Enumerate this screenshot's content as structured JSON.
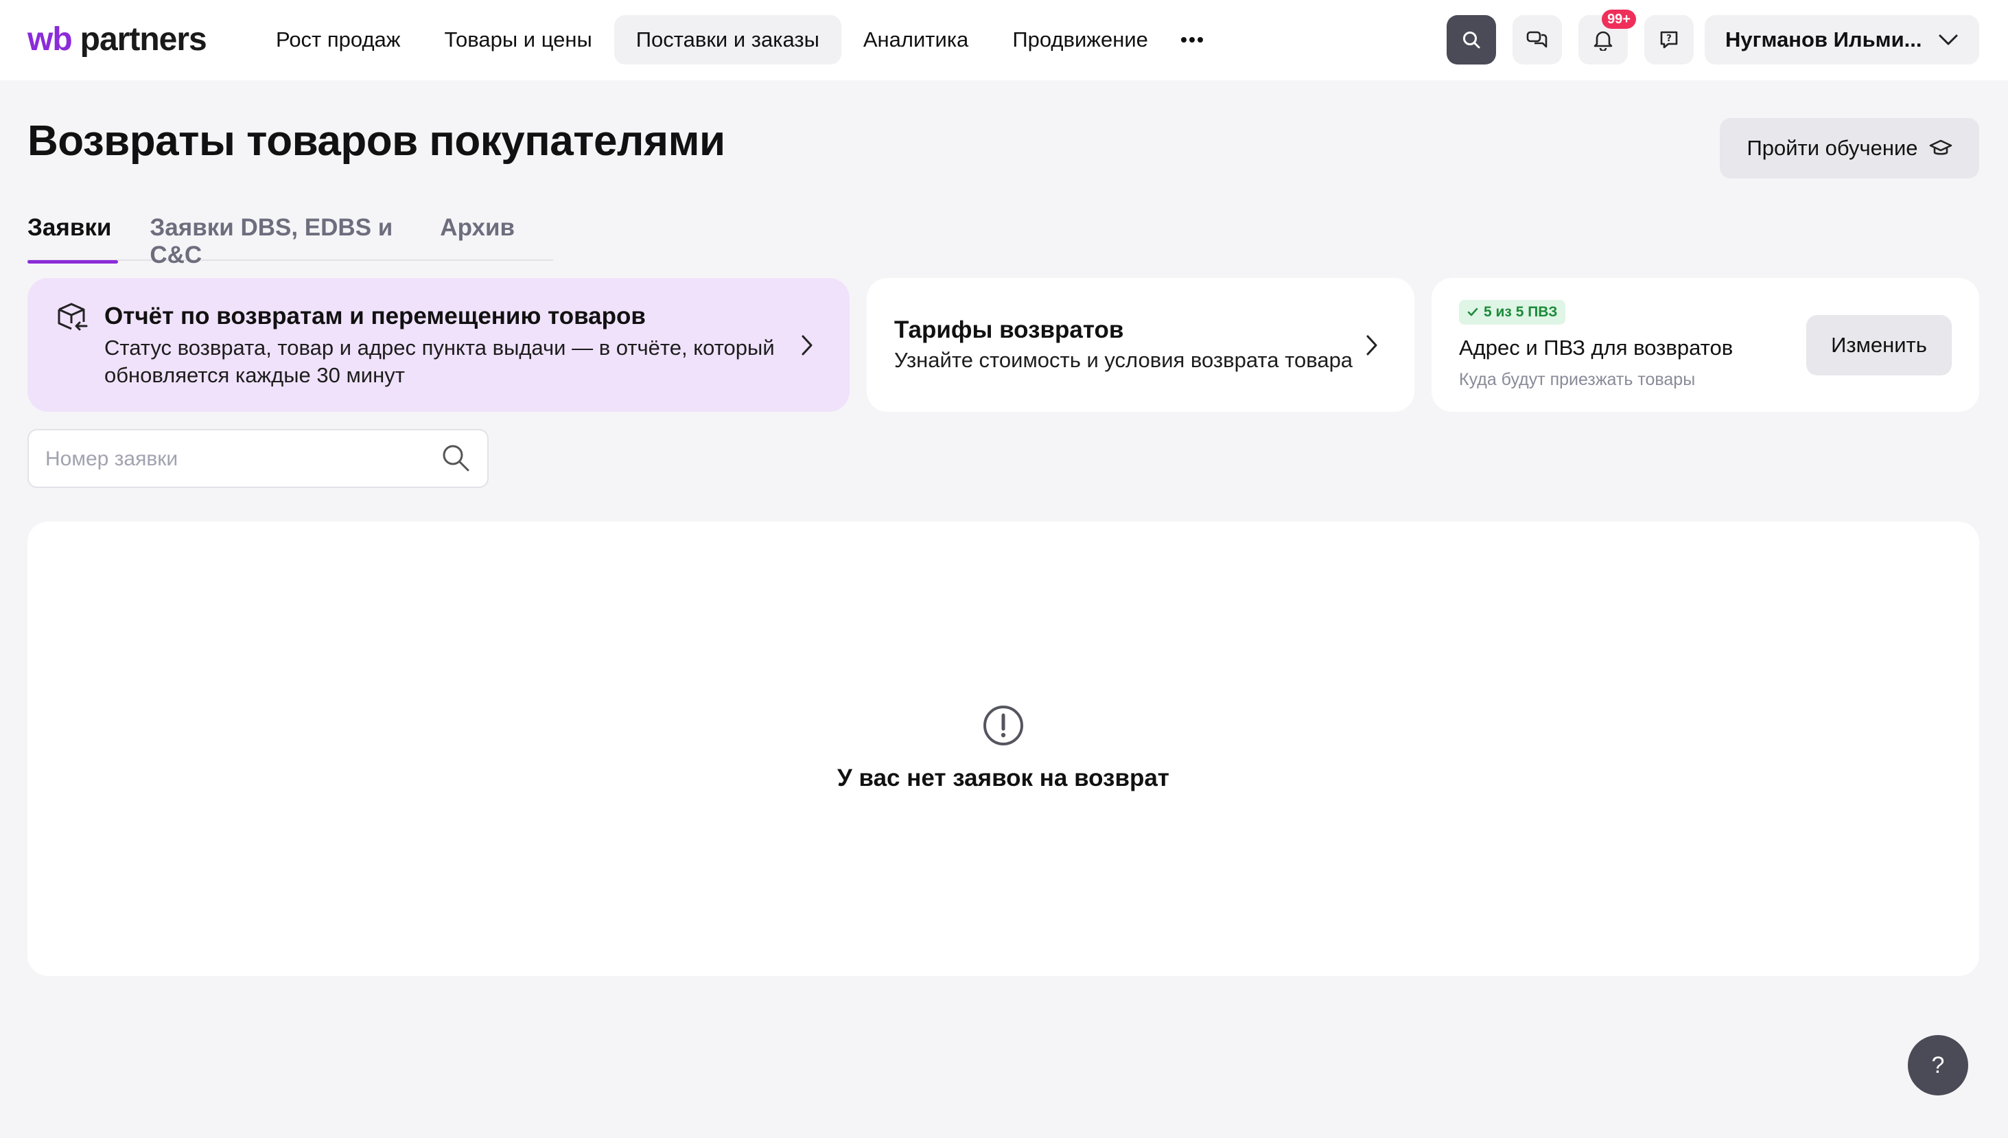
{
  "header": {
    "logo": {
      "wb": "wb",
      "partners": "partners"
    },
    "nav": [
      {
        "label": "Рост продаж"
      },
      {
        "label": "Товары и цены"
      },
      {
        "label": "Поставки и заказы"
      },
      {
        "label": "Аналитика"
      },
      {
        "label": "Продвижение"
      }
    ],
    "notifications_badge": "99+",
    "user_name": "Нугманов Ильми...",
    "icons": [
      "more-icon",
      "search-icon",
      "chat-icon",
      "bell-icon",
      "support-icon",
      "chevron-down-icon"
    ]
  },
  "page": {
    "title": "Возвраты товаров покупателями",
    "learn_button": "Пройти обучение"
  },
  "tabs": [
    {
      "label": "Заявки"
    },
    {
      "label": "Заявки DBS, EDBS и C&C"
    },
    {
      "label": "Архив"
    }
  ],
  "cards": {
    "report": {
      "title": "Отчёт по возвратам и перемещению товаров",
      "desc": "Статус возврата, товар и адрес пункта выдачи — в отчёте, который обновляется каждые 30 минут"
    },
    "tariffs": {
      "title": "Тарифы возвратов",
      "desc": "Узнайте стоимость и условия возврата товара"
    },
    "address": {
      "badge": "5 из 5 ПВЗ",
      "title": "Адрес и ПВЗ для возвратов",
      "subtitle": "Куда будут приезжать товары",
      "button": "Изменить"
    }
  },
  "search": {
    "placeholder": "Номер заявки",
    "value": ""
  },
  "empty_state": {
    "text": "У вас нет заявок на возврат"
  },
  "help_button": "?",
  "colors": {
    "accent": "#8b2bd9",
    "report_bg": "#f0e2fb",
    "badge_red": "#ef2f5a",
    "success": "#1b8a3a"
  }
}
